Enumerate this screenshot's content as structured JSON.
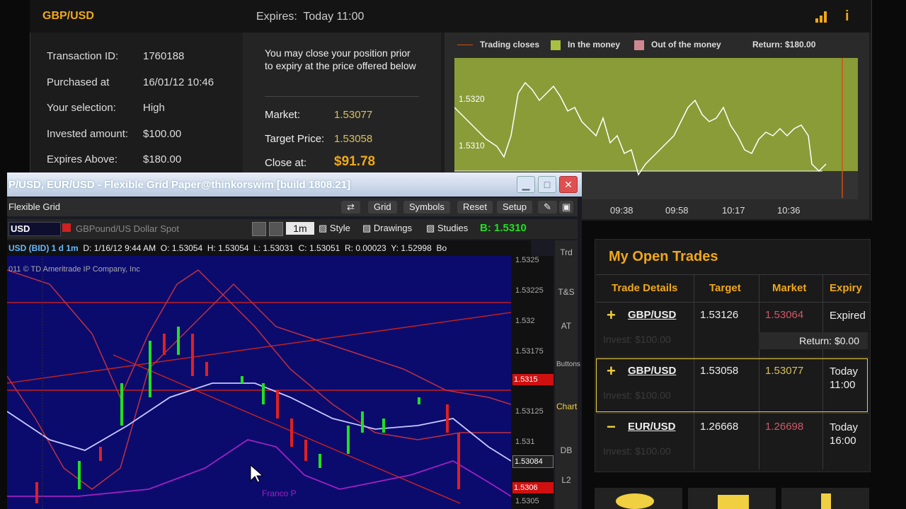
{
  "trade": {
    "pair": "GBP/USD",
    "expires_label": "Expires:",
    "expires_value": "Today 11:00",
    "details": [
      {
        "label": "Transaction ID:",
        "value": "1760188"
      },
      {
        "label": "Purchased at",
        "value": "16/01/12 10:46"
      },
      {
        "label": "Your selection:",
        "value": "High"
      },
      {
        "label": "Invested amount:",
        "value": "$100.00"
      },
      {
        "label": "Expires Above:",
        "value": "$180.00"
      }
    ],
    "close_text": "You may close your position prior to expiry at the price offered below",
    "market_label": "Market:",
    "market_value": "1.53077",
    "target_label": "Target Price:",
    "target_value": "1.53058",
    "close_label": "Close at:",
    "close_value": "$91.78"
  },
  "mini_chart": {
    "legend": {
      "trading_closes": "Trading closes",
      "in_money": "In the money",
      "out_money": "Out of the money",
      "return": "Return: $180.00"
    },
    "y_ticks": [
      "1.5320",
      "1.5310"
    ],
    "x_ticks": [
      "09:38",
      "09:58",
      "10:17",
      "10:36"
    ],
    "colors": {
      "in_money": "#8a9c38",
      "out_money": "#d08890",
      "line": "#ffffff",
      "close_line": "#d05010"
    }
  },
  "tos": {
    "title": "P/USD, EUR/USD - Flexible Grid Paper@thinkorswim [build 1808.21]",
    "grid_label": "Flexible Grid",
    "buttons": [
      "Grid",
      "Symbols",
      "Reset",
      "Setup"
    ],
    "symbol": "USD",
    "description": "GBPound/US Dollar Spot",
    "timeframe": "1m",
    "style": "Style",
    "drawings": "Drawings",
    "studies": "Studies",
    "bid": "B: 1.5310",
    "info": [
      "USD (BID) 1 d 1m",
      "D: 1/16/12 9:44 AM",
      "O: 1.53054",
      "H: 1.53054",
      "L: 1.53031",
      "C: 1.53051",
      "R: 0.00023",
      "Y: 1.52998",
      "Bo"
    ],
    "copyright": "011 © TD Ameritrade IP Company, Inc",
    "watermark": "Franco P",
    "y_ticks": [
      "1.5325",
      "1.53225",
      "1.532",
      "1.53175",
      "1.5315",
      "1.53125",
      "1.531",
      "1.53084",
      "1.5306",
      "1.5305"
    ],
    "side_tabs": [
      "Trd",
      "T&S",
      "AT",
      "Buttons",
      "Chart",
      "DB",
      "L2"
    ]
  },
  "open_trades": {
    "title": "My Open Trades",
    "headers": [
      "Trade Details",
      "Target",
      "Market",
      "Expiry"
    ],
    "rows": [
      {
        "icon": "+",
        "pair": "GBP/USD",
        "target": "1.53126",
        "market": "1.53064",
        "expiry": "Expired",
        "invest": "Invest: $100.00",
        "return": "Return: $0.00"
      },
      {
        "icon": "+",
        "pair": "GBP/USD",
        "target": "1.53058",
        "market": "1.53077",
        "expiry": "Today 11:00",
        "invest": "Invest: $100.00"
      },
      {
        "icon": "−",
        "pair": "EUR/USD",
        "target": "1.26668",
        "market": "1.26698",
        "expiry": "Today 16:00",
        "invest": "Invest: $100.00"
      }
    ]
  }
}
